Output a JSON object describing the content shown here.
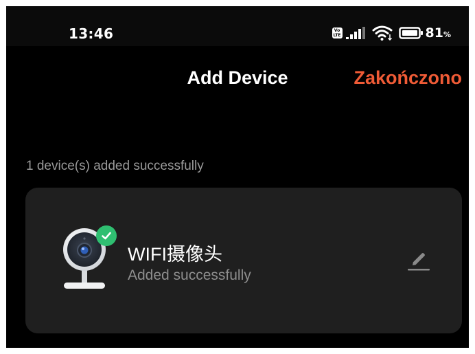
{
  "status_bar": {
    "time": "13:46",
    "volte_label_top": "Vo",
    "volte_label_bottom": "LTE",
    "battery_percent": "81",
    "battery_unit": "%"
  },
  "header": {
    "title": "Add Device",
    "done_label": "Zakończono",
    "accent_color": "#ef5b36"
  },
  "summary": {
    "text": "1 device(s) added successfully"
  },
  "devices": [
    {
      "name": "WIFI摄像头",
      "status": "Added successfully",
      "icon": "camera-icon",
      "badge_icon": "check-icon",
      "badge_color": "#2fbf71",
      "action_icon": "edit-pencil-icon"
    }
  ]
}
